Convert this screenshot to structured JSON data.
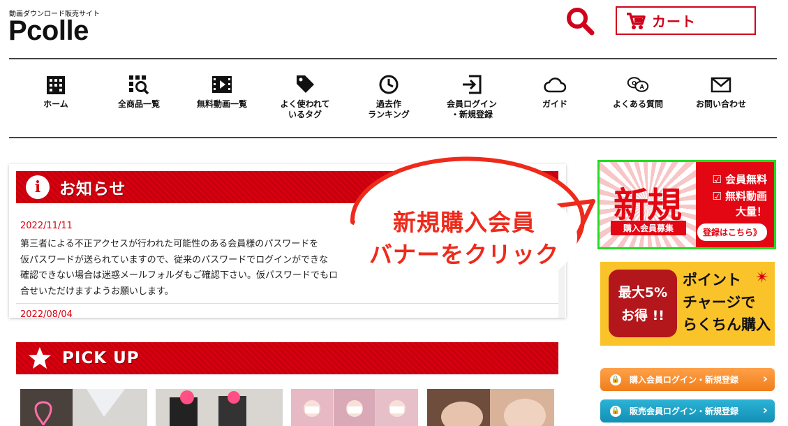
{
  "header": {
    "tagline": "動画ダウンロード販売サイト",
    "logo": "Pcolle",
    "search_icon": "search-icon",
    "cart_label": "カート",
    "cart_icon": "cart-icon",
    "accent": "#d0021b"
  },
  "nav": {
    "items": [
      {
        "label": "ホーム",
        "icon": "building-icon"
      },
      {
        "label": "全商品一覧",
        "icon": "grid-search-icon"
      },
      {
        "label": "無料動画一覧",
        "icon": "film-icon"
      },
      {
        "label": "よく使われて\nいるタグ",
        "icon": "tag-icon"
      },
      {
        "label": "過去作\nランキング",
        "icon": "clock-icon"
      },
      {
        "label": "会員ログイン\n・新規登録",
        "icon": "login-icon"
      },
      {
        "label": "ガイド",
        "icon": "cloud-icon"
      },
      {
        "label": "よくある質問",
        "icon": "qa-bubble-icon"
      },
      {
        "label": "お問い合わせ",
        "icon": "mail-icon"
      }
    ]
  },
  "news": {
    "title": "お知らせ",
    "entries": [
      {
        "date": "2022/11/11",
        "lines": [
          "第三者による不正アクセスが行われた可能性のある会員様のパスワードを",
          "仮パスワードが送られていますので、従来のパスワードでログインができな",
          "確認できない場合は迷惑メールフォルダもご確認下さい。仮パスワードでもロ",
          "合せいただけますようお願いします。"
        ]
      },
      {
        "date": "2022/08/04"
      }
    ]
  },
  "pickup": {
    "title": "PICK UP"
  },
  "banners": {
    "new_member": {
      "big": "新規",
      "sub": "購入会員募集",
      "feature1": "☑ 会員無料",
      "feature2": "☑ 無料動画",
      "feature3": "大量！",
      "cta": "登録はこちら》"
    },
    "point": {
      "line1": "最大5%",
      "line2": "お得 !!",
      "text1": "ポイント",
      "text2": "チャージで",
      "text3": "らくちん購入"
    },
    "buyer_login": "購入会員ログイン・新規登録",
    "seller_login": "販売会員ログイン・新規登録"
  },
  "callout": {
    "line1": "新規購入会員",
    "line2": "バナーをクリック"
  }
}
